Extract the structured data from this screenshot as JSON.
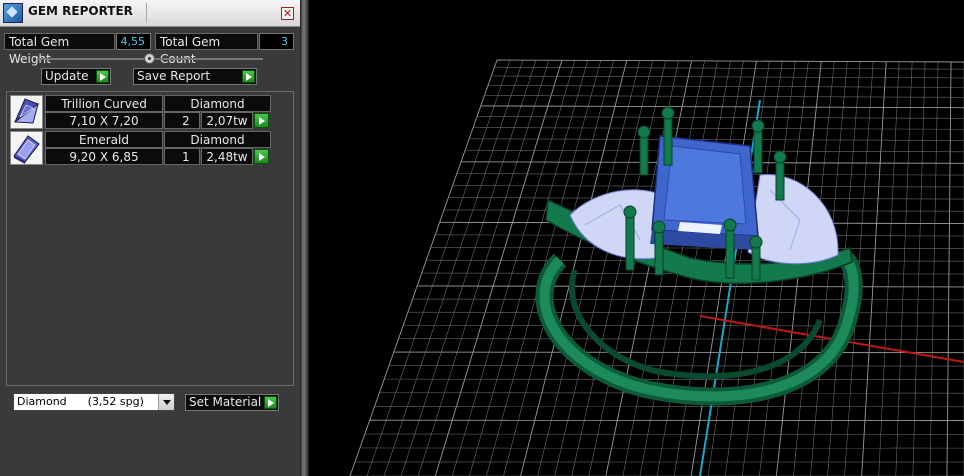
{
  "window": {
    "title": "GEM REPORTER",
    "close_glyph": "✕"
  },
  "stats": {
    "total_weight_label": "Total Gem Weight",
    "total_weight_value": "4,55",
    "total_count_label": "Total Gem Count",
    "total_count_value": "3"
  },
  "buttons": {
    "update": "Update",
    "save_report": "Save Report",
    "set_material": "Set Material"
  },
  "gems": [
    {
      "name": "Trillion Curved",
      "material": "Diamond",
      "size": "7,10 X 7,20",
      "count": "2",
      "weight": "2,07tw",
      "icon": "trillion-gem-icon"
    },
    {
      "name": "Emerald",
      "material": "Diamond",
      "size": "9,20 X 6,85",
      "count": "1",
      "weight": "2,48tw",
      "icon": "emerald-gem-icon"
    }
  ],
  "material_select": {
    "value": "Diamond      (3,52 spg)"
  },
  "colors": {
    "accent_green": "#2ca52c",
    "value_cyan": "#4ec9e8",
    "ring_green": "#0f6b43",
    "gem_blue": "#3f66cc"
  }
}
